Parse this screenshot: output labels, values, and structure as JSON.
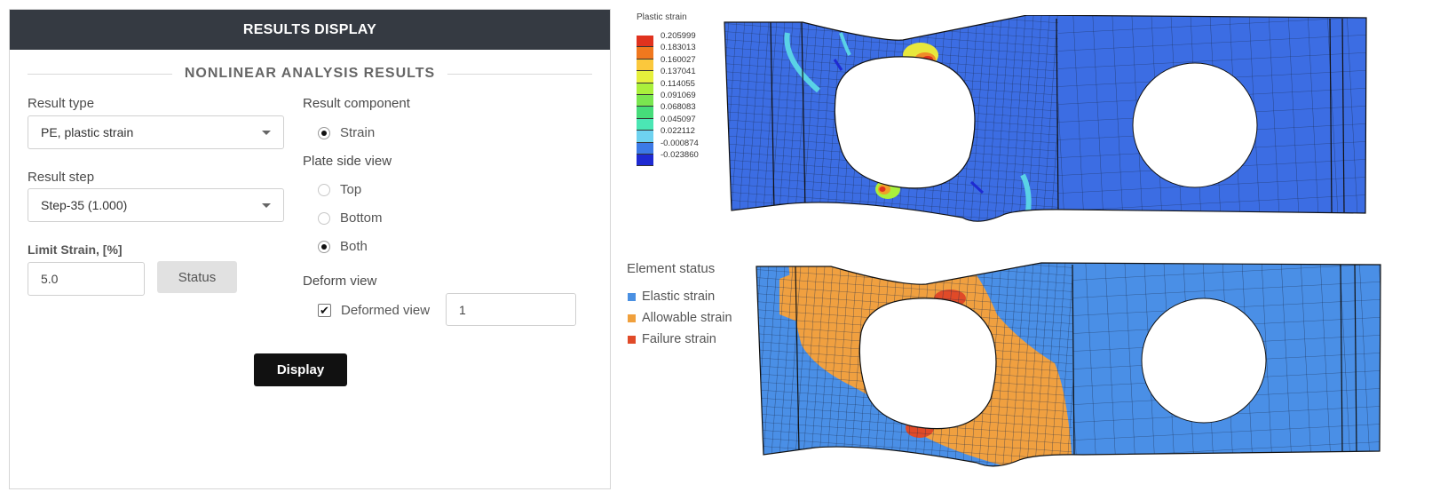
{
  "panel": {
    "header_title": "RESULTS DISPLAY",
    "section_title": "NONLINEAR ANALYSIS RESULTS",
    "result_type": {
      "label": "Result type",
      "value": "PE, plastic strain"
    },
    "result_step": {
      "label": "Result step",
      "value": "Step-35 (1.000)"
    },
    "limit_strain": {
      "label": "Limit Strain, [%]",
      "value": "5.0"
    },
    "status_button": "Status",
    "display_button": "Display",
    "result_component": {
      "label": "Result component",
      "options": [
        {
          "label": "Strain",
          "selected": true
        }
      ]
    },
    "plate_side_view": {
      "label": "Plate side view",
      "options": [
        {
          "label": "Top",
          "selected": false
        },
        {
          "label": "Bottom",
          "selected": false
        },
        {
          "label": "Both",
          "selected": true
        }
      ]
    },
    "deform_view": {
      "label": "Deform view",
      "checkbox_label": "Deformed view",
      "checked": true,
      "scale": "1"
    }
  },
  "contour_legend": {
    "title": "Plastic strain",
    "values": [
      "0.205999",
      "0.183013",
      "0.160027",
      "0.137041",
      "0.114055",
      "0.091069",
      "0.068083",
      "0.045097",
      "0.022112",
      "-0.000874",
      "-0.023860"
    ],
    "colors": [
      "#e0321e",
      "#f0781e",
      "#fbc83c",
      "#e6f03c",
      "#aaf03c",
      "#7ae650",
      "#46dc7a",
      "#4be6b4",
      "#6ed2f0",
      "#3c7ae6",
      "#1e2ad2"
    ]
  },
  "element_status": {
    "title": "Element status",
    "items": [
      {
        "label": "Elastic strain",
        "color": "#4a90e2"
      },
      {
        "label": "Allowable strain",
        "color": "#f0a03c"
      },
      {
        "label": "Failure strain",
        "color": "#e04a28"
      }
    ]
  },
  "colors": {
    "header_bg": "#353a42",
    "plate_contour": "#3a68e0",
    "plate_status_blue": "#4a8fe6",
    "plate_status_orange": "#f0a040"
  }
}
